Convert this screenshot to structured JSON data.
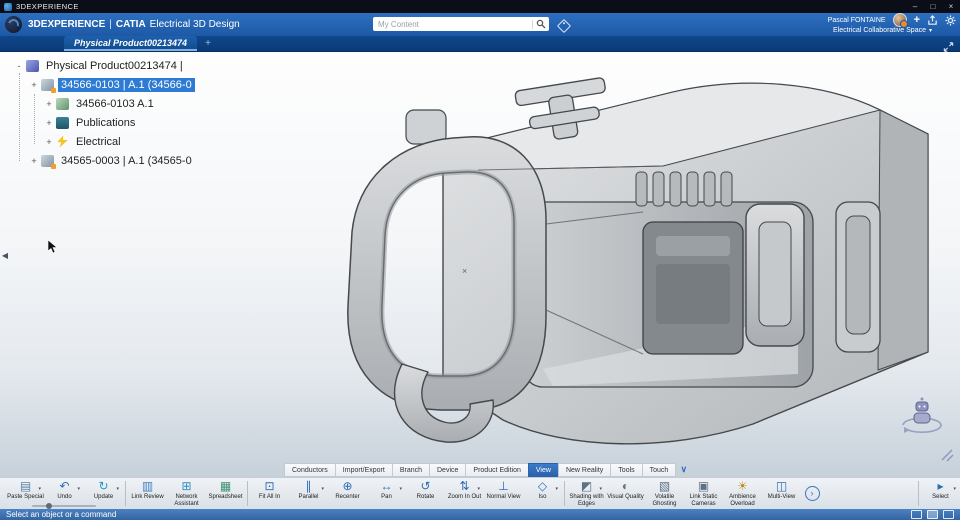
{
  "titlebar": {
    "app_name": "3DEXPERIENCE",
    "buttons": {
      "minimize": "–",
      "maximize": "□",
      "close": "×"
    }
  },
  "header": {
    "brand": "3DEXPERIENCE",
    "divider": "|",
    "product": "CATIA",
    "app": "Electrical 3D Design",
    "search_placeholder": "My Content",
    "user": "Pascal FONTAINE",
    "workspace": "Electrical Collaborative Space",
    "add_label": "+"
  },
  "tabbar": {
    "active_tab": "Physical Product00213474"
  },
  "tree": {
    "root": {
      "label": "Physical Product00213474 |",
      "icon": "product-icon",
      "expander": "-",
      "level": 0
    },
    "items": [
      {
        "label": "34566-0103 | A.1 (34566-0",
        "icon": "part-instance-icon",
        "level": 1,
        "selected": true,
        "expander": "+"
      },
      {
        "label": "34566-0103 A.1",
        "icon": "rep-3d-shape-icon",
        "level": 2,
        "expander": "+"
      },
      {
        "label": "Publications",
        "icon": "publications-icon",
        "level": 2,
        "expander": "+"
      },
      {
        "label": "Electrical",
        "icon": "electrical-icon",
        "level": 2,
        "expander": "+"
      },
      {
        "label": "34565-0003 | A.1 (34565-0",
        "icon": "part-instance-icon",
        "level": 1,
        "expander": "+"
      }
    ]
  },
  "viewport": {
    "center_marker": "×"
  },
  "ribbon": {
    "tabs": [
      {
        "label": "Conductors"
      },
      {
        "label": "Import/Export"
      },
      {
        "label": "Branch"
      },
      {
        "label": "Device"
      },
      {
        "label": "Product Edition"
      },
      {
        "label": "View",
        "active": true
      },
      {
        "label": "New Reality"
      },
      {
        "label": "Tools"
      },
      {
        "label": "Touch"
      }
    ]
  },
  "toolbar": {
    "groups": [
      {
        "items": [
          {
            "name": "paste-special",
            "label": "Paste Special",
            "glyph": "▤",
            "color": "#5b7fa6",
            "dropdown": true
          },
          {
            "name": "undo",
            "label": "Undo",
            "glyph": "↶",
            "color": "#2f6cb0",
            "dropdown": true
          },
          {
            "name": "update",
            "label": "Update",
            "glyph": "↻",
            "color": "#2796c9",
            "dropdown": true
          }
        ]
      },
      {
        "items": [
          {
            "name": "link-review",
            "label": "Link Review",
            "glyph": "▥",
            "color": "#3f7fc1"
          },
          {
            "name": "network-assistant",
            "label": "Network Assistant",
            "glyph": "⊞",
            "color": "#2f8fbf"
          },
          {
            "name": "spreadsheet",
            "label": "Spreadsheet",
            "glyph": "▦",
            "color": "#3f8f6f"
          }
        ]
      },
      {
        "items": [
          {
            "name": "fit-all-in",
            "label": "Fit All In",
            "glyph": "⊡",
            "color": "#2f6cb0"
          },
          {
            "name": "parallel",
            "label": "Parallel",
            "glyph": "∥",
            "color": "#2f6cb0",
            "dropdown": true
          },
          {
            "name": "recenter",
            "label": "Recenter",
            "glyph": "⊕",
            "color": "#2f6cb0"
          },
          {
            "name": "pan",
            "label": "Pan",
            "glyph": "↔",
            "color": "#2f6cb0",
            "dropdown": true
          },
          {
            "name": "rotate",
            "label": "Rotate",
            "glyph": "↺",
            "color": "#2f6cb0"
          },
          {
            "name": "zoom-in-out",
            "label": "Zoom In Out",
            "glyph": "⇅",
            "color": "#2f6cb0",
            "dropdown": true
          },
          {
            "name": "normal-view",
            "label": "Normal View",
            "glyph": "⊥",
            "color": "#2f6cb0"
          },
          {
            "name": "iso-view",
            "label": "Iso",
            "glyph": "◇",
            "color": "#2f6cb0",
            "dropdown": true
          }
        ]
      },
      {
        "items": [
          {
            "name": "shading-with-edges",
            "label": "Shading with Edges",
            "glyph": "◩",
            "color": "#5f7184",
            "dropdown": true
          },
          {
            "name": "visual-quality",
            "label": "Visual Quality",
            "glyph": "◐",
            "color": "#5f7184"
          },
          {
            "name": "volatile-ghosting",
            "label": "Volatile Ghosting",
            "glyph": "▧",
            "color": "#5f7184"
          },
          {
            "name": "link-static-cameras",
            "label": "Link Static Cameras",
            "glyph": "▣",
            "color": "#5f7184"
          },
          {
            "name": "ambience-overload",
            "label": "Ambience Overload",
            "glyph": "☀",
            "color": "#c08a2e"
          },
          {
            "name": "multi-view",
            "label": "Multi-View",
            "glyph": "◫",
            "color": "#2f6cb0"
          },
          {
            "name": "more-tools",
            "type": "more",
            "glyph": "›"
          }
        ]
      },
      {
        "align": "right",
        "items": [
          {
            "name": "select",
            "label": "Select",
            "glyph": "▸",
            "color": "#2f6cb0",
            "dropdown": true
          }
        ]
      }
    ]
  },
  "statusbar": {
    "message": "Select an object or a command"
  },
  "icons": {
    "caret_down": "▾",
    "collapse_left": "◀",
    "chevron_down": "∨",
    "more": "›",
    "new_tab": "+"
  }
}
